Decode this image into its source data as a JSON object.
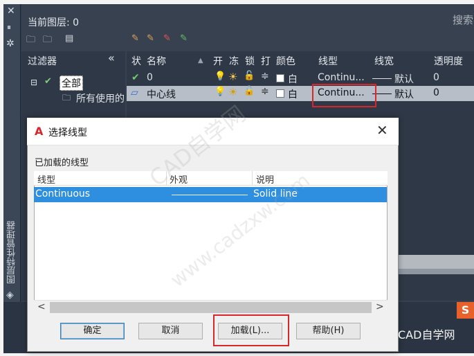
{
  "layer_manager": {
    "current_layer": "当前图层: 0",
    "search_placeholder": "搜索",
    "filters_label": "过滤器",
    "collapse_glyph": "«",
    "tree": {
      "all": "全部",
      "all_used": "所有使用的"
    },
    "side_title": "图层特性管理器",
    "columns": [
      "状",
      "名称",
      "开",
      "冻",
      "锁",
      "打",
      "颜色",
      "线型",
      "线宽",
      "透明度"
    ],
    "rows": [
      {
        "status": "✔",
        "name": "0",
        "color": "白",
        "linetype": "Continu...",
        "lineweight": "默认",
        "transparency": "0",
        "selected": false
      },
      {
        "status": "▱",
        "name": "中心线",
        "color": "白",
        "linetype": "Continu...",
        "lineweight": "默认",
        "transparency": "0",
        "selected": true
      }
    ]
  },
  "dialog": {
    "title": "选择线型",
    "close_glyph": "✕",
    "loaded_label": "已加载的线型",
    "columns": [
      "线型",
      "外观",
      "说明"
    ],
    "rows": [
      {
        "linetype": "Continuous",
        "description": "Solid line"
      }
    ],
    "buttons": {
      "ok": "确定",
      "cancel": "取消",
      "load": "加载(L)...",
      "help": "帮助(H)"
    },
    "scroll_left": "<",
    "scroll_right": ">"
  },
  "watermark": {
    "site": "CAD自学网",
    "url": "www.cadzxw.com",
    "badge": "S",
    "label": "CAD自学网"
  },
  "colors": {
    "accent_red": "#d9262b",
    "selection": "#2e8fe0",
    "dark_bg": "#2f3a4a"
  }
}
